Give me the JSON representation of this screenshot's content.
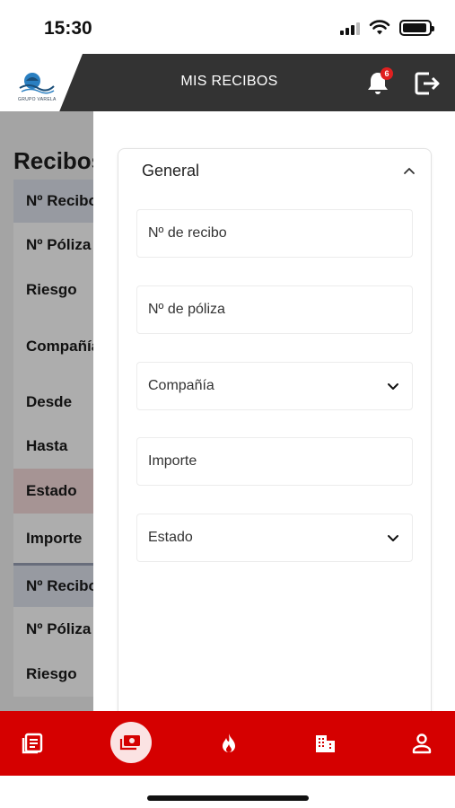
{
  "status_bar": {
    "time": "15:30"
  },
  "header": {
    "title": "MIS RECIBOS",
    "logo_text": "GRUPO VARELA",
    "notification_count": "6",
    "colors": {
      "background": "#333333",
      "accent": "#d50000"
    }
  },
  "background_page": {
    "title": "Recibos",
    "rows": [
      {
        "label": "Nº Recibo",
        "style": "head"
      },
      {
        "label": "Nº Póliza",
        "style": "plain"
      },
      {
        "label": "Riesgo",
        "style": "plain"
      },
      {
        "label": "Compañía",
        "style": "plain"
      },
      {
        "label": "Desde",
        "style": "plain"
      },
      {
        "label": "Hasta",
        "style": "plain"
      },
      {
        "label": "Estado",
        "style": "estado"
      },
      {
        "label": "Importe",
        "style": "plain"
      },
      {
        "label": "Nº Recibo",
        "style": "head"
      },
      {
        "label": "Nº Póliza",
        "style": "plain"
      },
      {
        "label": "Riesgo",
        "style": "plain"
      }
    ]
  },
  "filter_panel": {
    "section_title": "General",
    "fields": {
      "recibo": {
        "placeholder": "Nº de recibo"
      },
      "poliza": {
        "placeholder": "Nº de póliza"
      },
      "compania": {
        "placeholder": "Compañía"
      },
      "importe": {
        "placeholder": "Importe"
      },
      "estado": {
        "placeholder": "Estado"
      }
    }
  },
  "bottom_nav": {
    "items": [
      "policies-icon",
      "receipts-icon",
      "claims-icon",
      "companies-icon",
      "profile-icon"
    ],
    "active": "receipts-icon"
  }
}
